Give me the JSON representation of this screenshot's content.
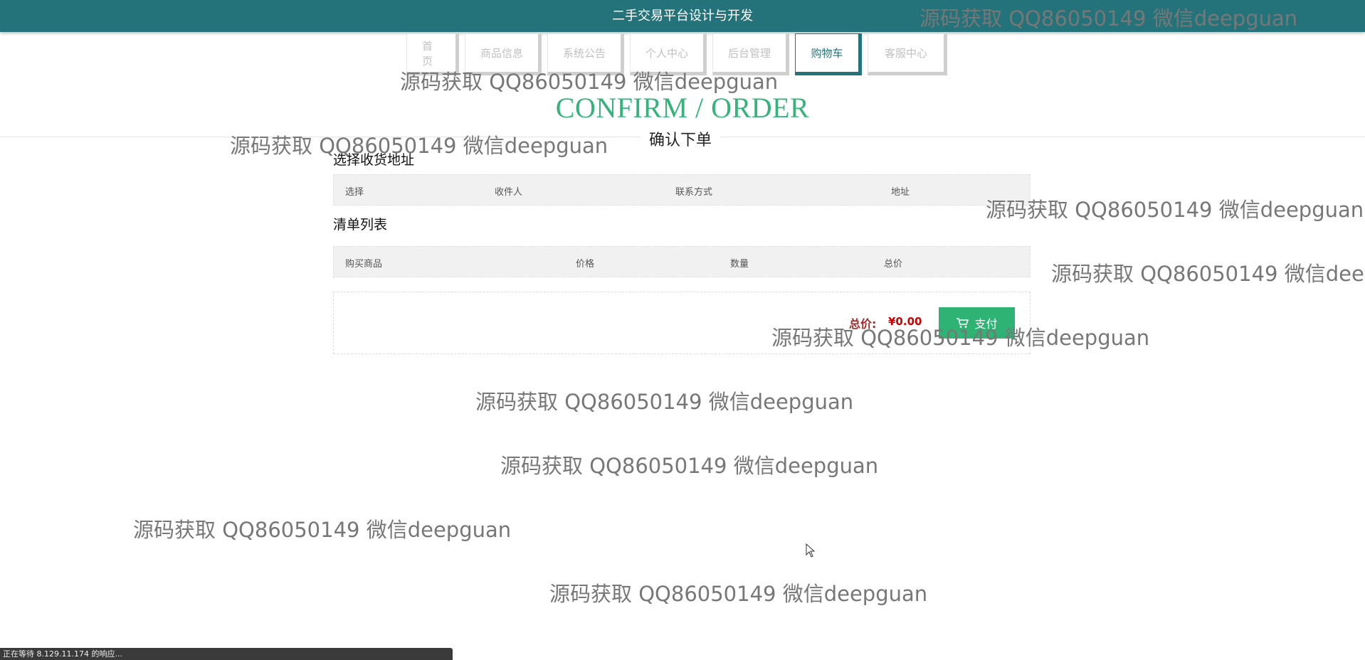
{
  "site": {
    "title": "二手交易平台设计与开发"
  },
  "nav": {
    "tabs": [
      {
        "label": "首页",
        "active": false
      },
      {
        "label": "商品信息",
        "active": false
      },
      {
        "label": "系统公告",
        "active": false
      },
      {
        "label": "个人中心",
        "active": false
      },
      {
        "label": "后台管理",
        "active": false
      },
      {
        "label": "购物车",
        "active": true
      },
      {
        "label": "客服中心",
        "active": false
      }
    ]
  },
  "page": {
    "heading_en": "CONFIRM / ORDER",
    "heading_cn": "确认下单"
  },
  "address": {
    "label": "选择收货地址",
    "columns": [
      "选择",
      "收件人",
      "联系方式",
      "地址"
    ]
  },
  "items": {
    "label": "清单列表",
    "columns": [
      "购买商品",
      "价格",
      "数量",
      "总价"
    ]
  },
  "summary": {
    "total_label": "总价:",
    "total_value": "¥0.00",
    "pay_label": "支付"
  },
  "watermark": {
    "text": "源码获取 QQ86050149 微信deepguan"
  },
  "statusbar": {
    "text": "正在等待 8.129.11.174 的响应..."
  },
  "colors": {
    "topbar": "#24737a",
    "accent": "#34b37a",
    "pay_button": "#2fb374",
    "total": "#cc0000"
  }
}
